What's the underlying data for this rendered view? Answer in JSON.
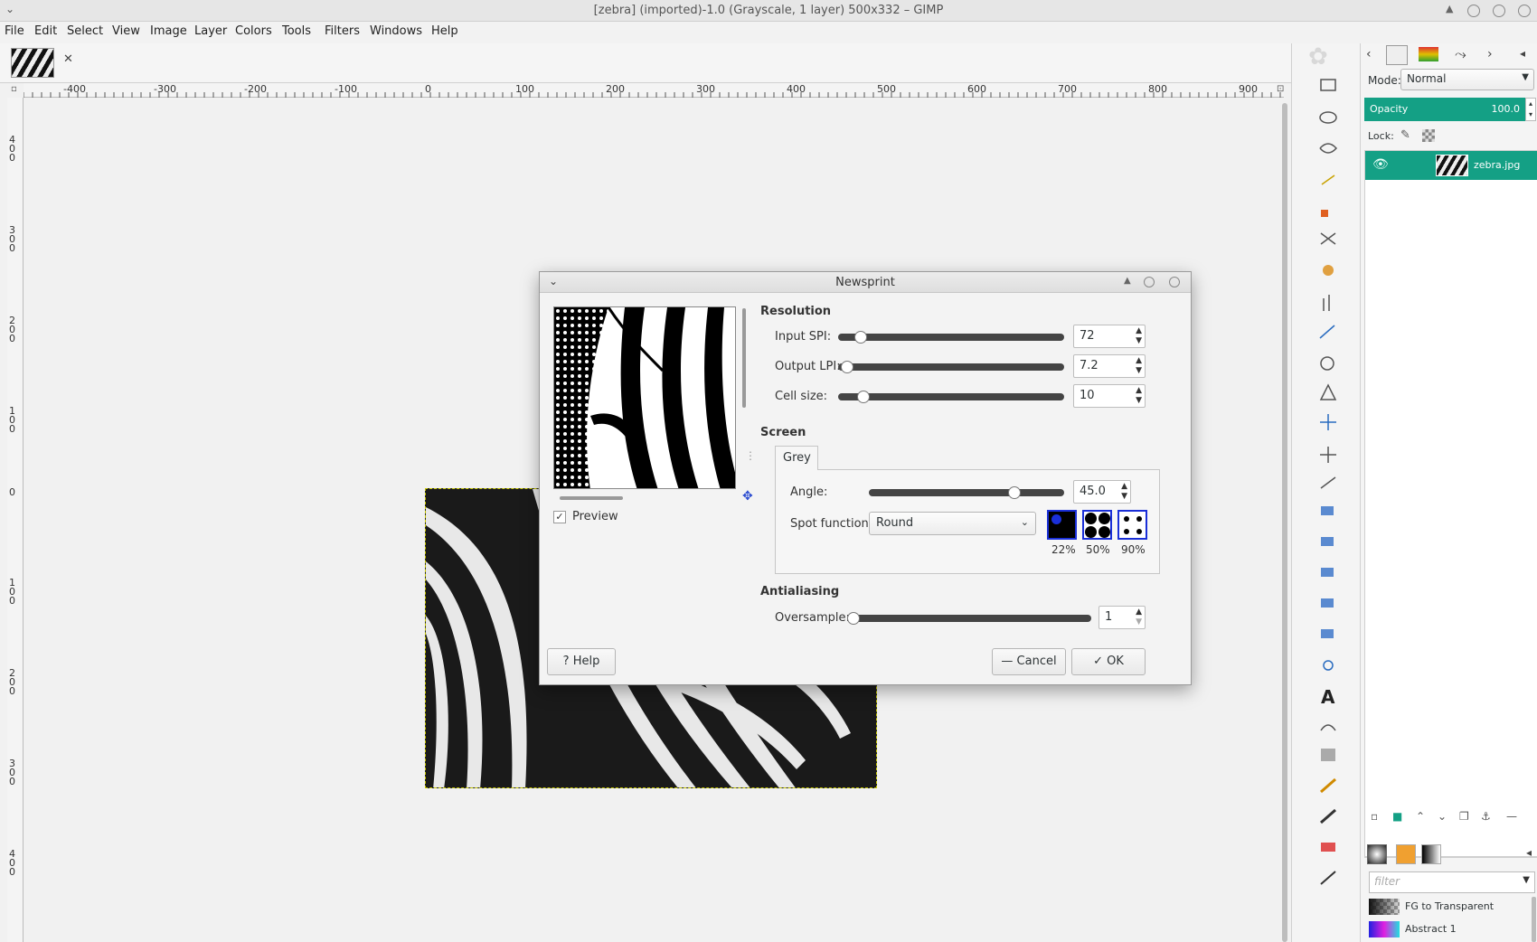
{
  "window": {
    "title": "[zebra] (imported)-1.0 (Grayscale, 1 layer) 500x332 – GIMP"
  },
  "menubar": {
    "items": [
      "File",
      "Edit",
      "Select",
      "View",
      "Image",
      "Layer",
      "Colors",
      "Tools",
      "Filters",
      "Windows",
      "Help"
    ]
  },
  "ruler": {
    "h_labels": [
      "-400",
      "-300",
      "-200",
      "-100",
      "0",
      "100",
      "200",
      "300",
      "400",
      "500",
      "600",
      "700",
      "800",
      "900"
    ],
    "v_labels": [
      "4\n0\n0",
      "3\n0\n0",
      "2\n0\n0",
      "1\n0\n0",
      "0",
      "1\n0\n0",
      "2\n0\n0",
      "3\n0\n0",
      "4\n0\n0"
    ]
  },
  "dialog": {
    "title": "Newsprint",
    "preview_label": "Preview",
    "preview_checked": true,
    "resolution": {
      "heading": "Resolution",
      "input_spi_label": "Input SPI:",
      "input_spi_value": "72",
      "output_lpi_label": "Output LPI:",
      "output_lpi_value": "7.2",
      "cell_size_label": "Cell size:",
      "cell_size_value": "10"
    },
    "screen": {
      "heading": "Screen",
      "tab_label": "Grey",
      "angle_label": "Angle:",
      "angle_value": "45.0",
      "spot_function_label": "Spot function:",
      "spot_function_value": "Round",
      "spot_percentages": [
        "22%",
        "50%",
        "90%"
      ]
    },
    "antialiasing": {
      "heading": "Antialiasing",
      "oversample_label": "Oversample:",
      "oversample_value": "1"
    },
    "buttons": {
      "help": "Help",
      "cancel": "Cancel",
      "ok": "OK"
    }
  },
  "layers_panel": {
    "mode_label": "Mode:",
    "mode_value": "Normal",
    "opacity_label": "Opacity",
    "opacity_value": "100.0",
    "lock_label": "Lock:",
    "layer_name": "zebra.jpg"
  },
  "gradients_panel": {
    "filter_placeholder": "filter",
    "items": [
      "FG to Transparent",
      "Abstract 1"
    ]
  },
  "colors": {
    "accent_teal": "#14a085",
    "dialog_bg": "#f3f3f3"
  }
}
